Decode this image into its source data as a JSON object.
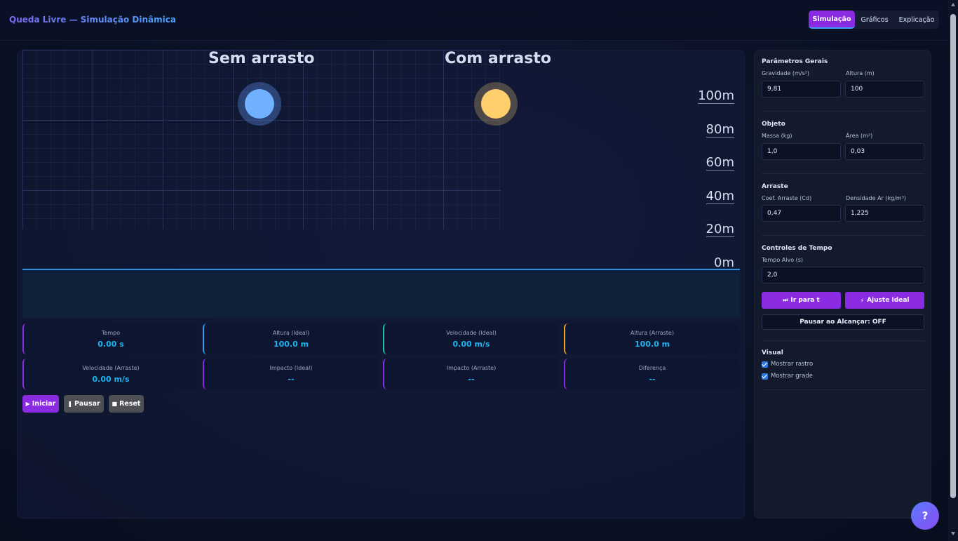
{
  "header": {
    "title": "Queda Livre — Simulação Dinâmica",
    "tabs": [
      "Simulação",
      "Gráficos",
      "Explicação"
    ]
  },
  "canvas": {
    "title_ideal": "Sem arrasto",
    "title_drag": "Com arrasto",
    "scale": [
      "100m",
      "80m",
      "60m",
      "40m",
      "20m",
      "0m"
    ]
  },
  "stats": [
    {
      "label": "Tempo",
      "value": "0.00 s"
    },
    {
      "label": "Altura (Ideal)",
      "value": "100.0 m"
    },
    {
      "label": "Velocidade (Ideal)",
      "value": "0.00 m/s"
    },
    {
      "label": "Altura (Arraste)",
      "value": "100.0 m"
    },
    {
      "label": "Velocidade (Arraste)",
      "value": "0.00 m/s"
    },
    {
      "label": "Impacto (Ideal)",
      "value": "--"
    },
    {
      "label": "Impacto (Arraste)",
      "value": "--"
    },
    {
      "label": "Diferença",
      "value": "--"
    }
  ],
  "controls": {
    "start": "Iniciar",
    "pause": "Pausar",
    "reset": "Reset"
  },
  "sidebar": {
    "general": {
      "title": "Parâmetros Gerais",
      "gravity_label": "Gravidade (m/s²)",
      "gravity_value": "9,81",
      "height_label": "Altura (m)",
      "height_value": "100"
    },
    "object": {
      "title": "Objeto",
      "mass_label": "Massa (kg)",
      "mass_value": "1,0",
      "area_label": "Área (m²)",
      "area_value": "0,03"
    },
    "drag": {
      "title": "Arraste",
      "cd_label": "Coef. Arraste (Cd)",
      "cd_value": "0,47",
      "rho_label": "Densidade Ar (kg/m³)",
      "rho_value": "1,225"
    },
    "time": {
      "title": "Controles de Tempo",
      "target_label": "Tempo Alvo (s)",
      "target_value": "2,0",
      "goto_button": "Ir para t",
      "fit_button": "Ajuste Ideal",
      "pause_toggle": "Pausar ao Alcançar: OFF"
    },
    "visual": {
      "title": "Visual",
      "show_trail": "Mostrar rastro",
      "show_grid": "Mostrar grade"
    }
  },
  "help": "?"
}
